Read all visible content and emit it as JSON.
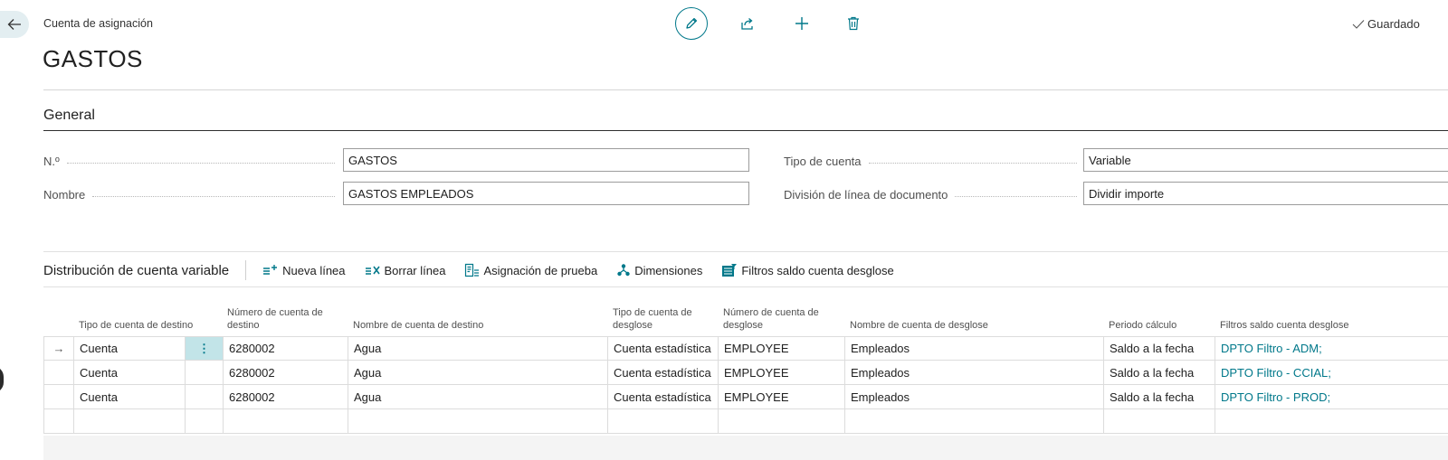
{
  "header": {
    "breadcrumb": "Cuenta de asignación",
    "title": "GASTOS",
    "status": "Guardado"
  },
  "general": {
    "section_title": "General",
    "fields": [
      {
        "label": "N.º",
        "value": "GASTOS"
      },
      {
        "label": "Nombre",
        "value": "GASTOS EMPLEADOS"
      },
      {
        "label": "Tipo de cuenta",
        "value": "Variable"
      },
      {
        "label": "División de línea de documento",
        "value": "Dividir importe"
      }
    ]
  },
  "lines": {
    "title": "Distribución de cuenta variable",
    "actions": [
      {
        "label": "Nueva línea",
        "icon": "new-line-icon"
      },
      {
        "label": "Borrar línea",
        "icon": "delete-line-icon"
      },
      {
        "label": "Asignación de prueba",
        "icon": "test-allocation-icon"
      },
      {
        "label": "Dimensiones",
        "icon": "dimensions-icon"
      },
      {
        "label": "Filtros saldo cuenta desglose",
        "icon": "filter-icon"
      }
    ],
    "columns": [
      "Tipo de cuenta de destino",
      "Número de cuenta de destino",
      "Nombre de cuenta de destino",
      "Tipo de cuenta de desglose",
      "Número de cuenta de desglose",
      "Nombre de cuenta de desglose",
      "Periodo cálculo",
      "Filtros saldo cuenta desglose"
    ],
    "rows": [
      [
        "Cuenta",
        "6280002",
        "Agua",
        "Cuenta estadística",
        "EMPLOYEE",
        "Empleados",
        "Saldo a la fecha",
        "DPTO Filtro - ADM;"
      ],
      [
        "Cuenta",
        "6280002",
        "Agua",
        "Cuenta estadística",
        "EMPLOYEE",
        "Empleados",
        "Saldo a la fecha",
        "DPTO Filtro - CCIAL;"
      ],
      [
        "Cuenta",
        "6280002",
        "Agua",
        "Cuenta estadística",
        "EMPLOYEE",
        "Empleados",
        "Saldo a la fecha",
        "DPTO Filtro - PROD;"
      ],
      [
        "",
        "",
        "",
        "",
        "",
        "",
        "",
        ""
      ]
    ],
    "row_menu_glyph": "⋮",
    "current_row_glyph": "→"
  },
  "colors": {
    "accent": "#00788a",
    "selected_cell": "#c2e4e8",
    "back_button": "#e3eef1"
  }
}
